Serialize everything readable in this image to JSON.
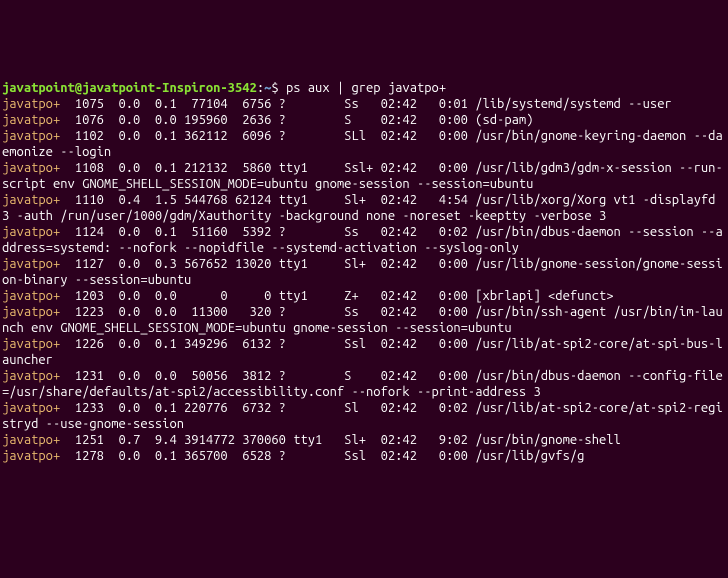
{
  "prompt": {
    "user_host": "javatpoint@javatpoint-Inspiron-3542",
    "colon": ":",
    "path": "~",
    "dollar": "$ ",
    "command": "ps aux | grep javatpo+"
  },
  "rows": [
    {
      "user": "javatpo+",
      "rest": "  1075  0.0  0.1  77104  6756 ?        Ss   02:42   0:01 /lib/systemd/systemd --user"
    },
    {
      "user": "javatpo+",
      "rest": "  1076  0.0  0.0 195960  2636 ?        S    02:42   0:00 (sd-pam)"
    },
    {
      "user": "javatpo+",
      "rest": "  1102  0.0  0.1 362112  6096 ?        SLl  02:42   0:00 /usr/bin/gnome-keyring-daemon --daemonize --login"
    },
    {
      "user": "javatpo+",
      "rest": "  1108  0.0  0.1 212132  5860 tty1     Ssl+ 02:42   0:00 /usr/lib/gdm3/gdm-x-session --run-script env GNOME_SHELL_SESSION_MODE=ubuntu gnome-session --session=ubuntu"
    },
    {
      "user": "javatpo+",
      "rest": "  1110  0.4  1.5 544768 62124 tty1     Sl+  02:42   4:54 /usr/lib/xorg/Xorg vt1 -displayfd 3 -auth /run/user/1000/gdm/Xauthority -background none -noreset -keeptty -verbose 3"
    },
    {
      "user": "javatpo+",
      "rest": "  1124  0.0  0.1  51160  5392 ?        Ss   02:42   0:02 /usr/bin/dbus-daemon --session --address=systemd: --nofork --nopidfile --systemd-activation --syslog-only"
    },
    {
      "user": "javatpo+",
      "rest": "  1127  0.0  0.3 567652 13020 tty1     Sl+  02:42   0:00 /usr/lib/gnome-session/gnome-session-binary --session=ubuntu"
    },
    {
      "user": "javatpo+",
      "rest": "  1203  0.0  0.0      0     0 tty1     Z+   02:42   0:00 [xbrlapi] <defunct>"
    },
    {
      "user": "javatpo+",
      "rest": "  1223  0.0  0.0  11300   320 ?        Ss   02:42   0:00 /usr/bin/ssh-agent /usr/bin/im-launch env GNOME_SHELL_SESSION_MODE=ubuntu gnome-session --session=ubuntu"
    },
    {
      "user": "javatpo+",
      "rest": "  1226  0.0  0.1 349296  6132 ?        Ssl  02:42   0:00 /usr/lib/at-spi2-core/at-spi-bus-launcher"
    },
    {
      "user": "javatpo+",
      "rest": "  1231  0.0  0.0  50056  3812 ?        S    02:42   0:00 /usr/bin/dbus-daemon --config-file=/usr/share/defaults/at-spi2/accessibility.conf --nofork --print-address 3"
    },
    {
      "user": "javatpo+",
      "rest": "  1233  0.0  0.1 220776  6732 ?        Sl   02:42   0:02 /usr/lib/at-spi2-core/at-spi2-registryd --use-gnome-session"
    },
    {
      "user": "javatpo+",
      "rest": "  1251  0.7  9.4 3914772 370060 tty1   Sl+  02:42   9:02 /usr/bin/gnome-shell"
    },
    {
      "user": "javatpo+",
      "rest": "  1278  0.0  0.1 365700  6528 ?        Ssl  02:42   0:00 /usr/lib/gvfs/g"
    }
  ]
}
